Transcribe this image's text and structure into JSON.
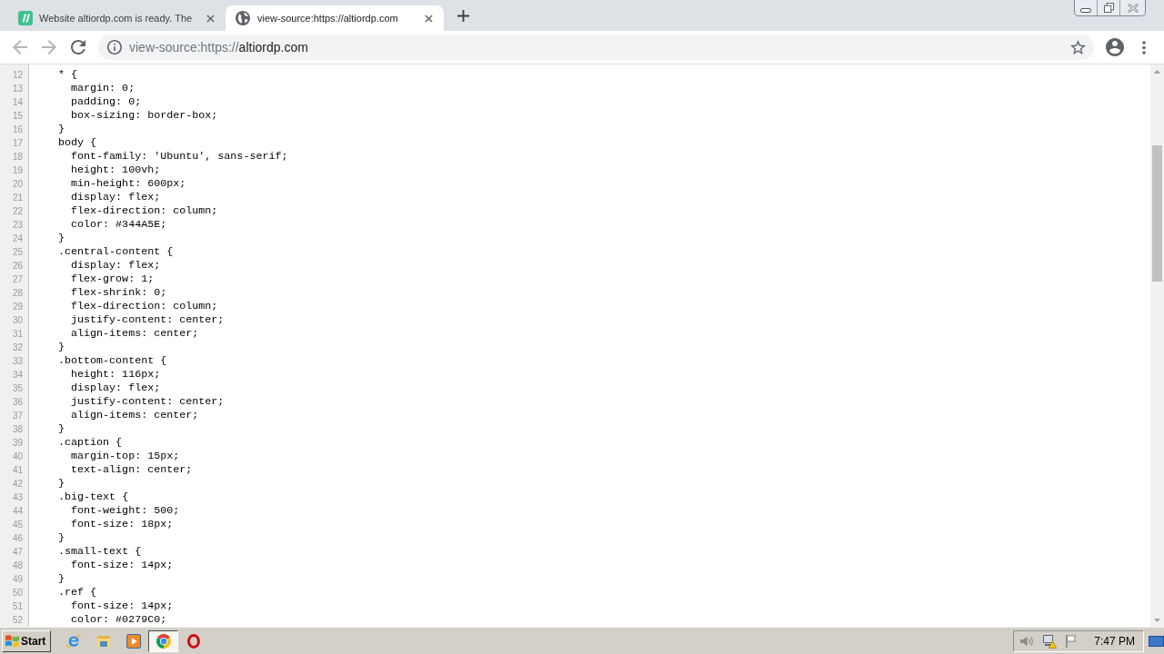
{
  "browser": {
    "tabs": [
      {
        "kind": "favicon",
        "title": "Website altiordp.com is ready. The",
        "selected": false
      },
      {
        "kind": "default",
        "title": "view-source:https://altiordp.com",
        "selected": true
      }
    ],
    "address_bar": {
      "scheme": "view-source:https://",
      "host": "altiordp.com"
    }
  },
  "source": {
    "lines": [
      {
        "number": "12",
        "text": "* {",
        "children": [
          {
            "number": "13",
            "text": "margin: 0;"
          },
          {
            "number": "14",
            "text": "padding: 0;"
          },
          {
            "number": "15",
            "text": "box-sizing: border-box;"
          }
        ]
      },
      {
        "number": "16",
        "text": "}"
      },
      {
        "number": "17",
        "text": "body {",
        "children": [
          {
            "number": "18",
            "text": "font-family: 'Ubuntu', sans-serif;"
          },
          {
            "number": "19",
            "text": "height: 100vh;"
          },
          {
            "number": "20",
            "text": "min-height: 600px;"
          },
          {
            "number": "21",
            "text": "display: flex;"
          },
          {
            "number": "22",
            "text": "flex-direction: column;"
          },
          {
            "number": "23",
            "text": "color: #344A5E;"
          }
        ]
      },
      {
        "number": "24",
        "text": "}"
      },
      {
        "number": "25",
        "text": ".central-content {",
        "children": [
          {
            "number": "26",
            "text": "display: flex;"
          },
          {
            "number": "27",
            "text": "flex-grow: 1;"
          },
          {
            "number": "28",
            "text": "flex-shrink: 0;"
          },
          {
            "number": "29",
            "text": "flex-direction: column;"
          },
          {
            "number": "30",
            "text": "justify-content: center;"
          },
          {
            "number": "31",
            "text": "align-items: center;"
          }
        ]
      },
      {
        "number": "32",
        "text": "}"
      },
      {
        "number": "33",
        "text": ".bottom-content {",
        "children": [
          {
            "number": "34",
            "text": "height: 116px;"
          },
          {
            "number": "35",
            "text": "display: flex;"
          },
          {
            "number": "36",
            "text": "justify-content: center;"
          },
          {
            "number": "37",
            "text": "align-items: center;"
          }
        ]
      },
      {
        "number": "38",
        "text": "}"
      },
      {
        "number": "39",
        "text": ".caption {",
        "children": [
          {
            "number": "40",
            "text": "margin-top: 15px;"
          },
          {
            "number": "41",
            "text": "text-align: center;"
          }
        ]
      },
      {
        "number": "42",
        "text": "}"
      },
      {
        "number": "43",
        "text": ".big-text {",
        "children": [
          {
            "number": "44",
            "text": "font-weight: 500;"
          },
          {
            "number": "45",
            "text": "font-size: 18px;"
          }
        ]
      },
      {
        "number": "46",
        "text": "}"
      },
      {
        "number": "47",
        "text": ".small-text {",
        "children": [
          {
            "number": "48",
            "text": "font-size: 14px;"
          }
        ]
      },
      {
        "number": "49",
        "text": "}"
      },
      {
        "number": "50",
        "text": ".ref {",
        "children": [
          {
            "number": "51",
            "text": "font-size: 14px;"
          },
          {
            "number": "52",
            "text": "color: #0279C0;"
          }
        ]
      }
    ]
  },
  "taskbar": {
    "start": "Start",
    "apps": [
      {
        "kind": "ebrowser",
        "selected": false
      },
      {
        "kind": "folder",
        "selected": false
      },
      {
        "kind": "player",
        "selected": false
      },
      {
        "kind": "cbrowser",
        "selected": true
      },
      {
        "kind": "obrowser",
        "selected": false
      }
    ],
    "clock": "7:47 PM"
  }
}
